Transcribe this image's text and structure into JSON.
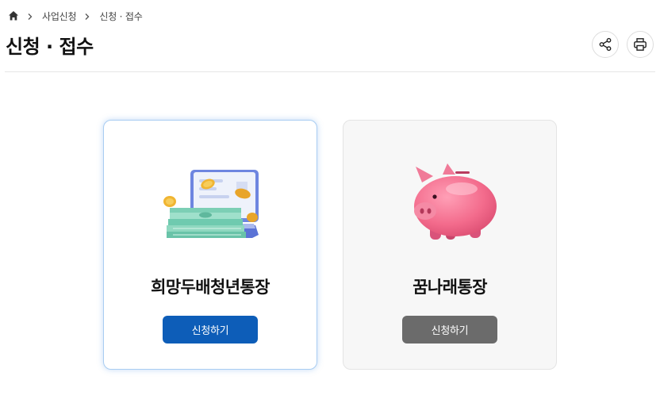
{
  "breadcrumb": {
    "home_icon": "home-icon",
    "items": [
      "사업신청",
      "신청 · 접수"
    ]
  },
  "header": {
    "title": "신청 · 접수",
    "share_icon": "share-icon",
    "print_icon": "print-icon"
  },
  "cards": [
    {
      "name": "희망두배청년통장",
      "button_label": "신청하기",
      "illustration": "laptop-money-icon",
      "button_color": "#0d5db8"
    },
    {
      "name": "꿈나래통장",
      "button_label": "신청하기",
      "illustration": "piggy-bank-icon",
      "button_color": "#6b6b6b"
    }
  ]
}
